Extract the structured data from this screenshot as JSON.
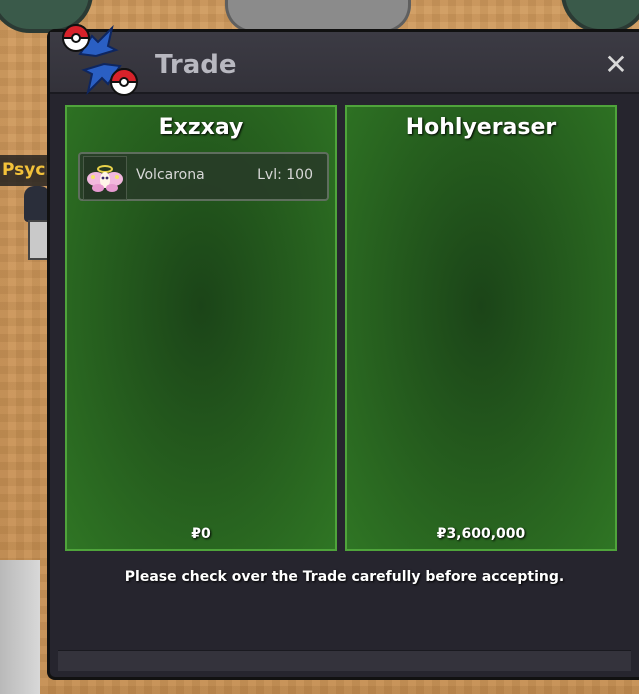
{
  "background": {
    "nametag": "Psycl"
  },
  "window": {
    "title": "Trade",
    "close_glyph": "✕",
    "logo_icon": "trade-pokeball-arrows-icon"
  },
  "left_panel": {
    "player": "Exzxay",
    "money": "₽0",
    "offers": [
      {
        "pokemon": "Volcarona",
        "level": "Lvl: 100",
        "icon": "volcarona-sprite-icon"
      }
    ]
  },
  "right_panel": {
    "player": "Hohlyeraser",
    "money": "₽3,600,000",
    "offers": []
  },
  "notice": "Please check over the Trade carefully before accepting.",
  "colors": {
    "panel_green": "#2f7524",
    "panel_border": "#4fa43b",
    "window_bg": "#26252e",
    "title_text": "#b8b8c0",
    "nametag_text": "#f3c23a"
  }
}
